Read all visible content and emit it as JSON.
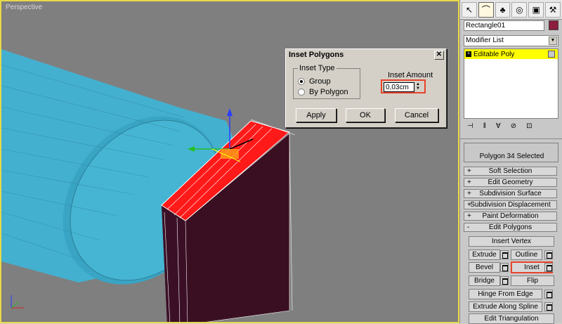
{
  "viewport": {
    "label": "Perspective"
  },
  "dialog": {
    "title": "Inset Polygons",
    "close_glyph": "✕",
    "inset_type_label": "Inset Type",
    "options": [
      "Group",
      "By Polygon"
    ],
    "selected_option": "Group",
    "inset_amount_label": "Inset Amount",
    "inset_amount_value": "0,03cm",
    "buttons": {
      "apply": "Apply",
      "ok": "OK",
      "cancel": "Cancel"
    }
  },
  "panel": {
    "tab_icons": [
      "create-icon",
      "modify-icon",
      "hierarchy-icon",
      "motion-icon",
      "display-icon",
      "utilities-icon"
    ],
    "object_name": "Rectangle01",
    "object_color": "#8c1e3e",
    "modifier_list": "Modifier List",
    "stack_item": "Editable Poly",
    "selection_text": "Polygon 34 Selected",
    "rollouts": [
      {
        "sign": "+",
        "label": "Soft Selection"
      },
      {
        "sign": "+",
        "label": "Edit Geometry"
      },
      {
        "sign": "+",
        "label": "Subdivision Surface"
      },
      {
        "sign": "+",
        "label": "Subdivision Displacement"
      },
      {
        "sign": "+",
        "label": "Paint Deformation"
      },
      {
        "sign": "-",
        "label": "Edit Polygons"
      }
    ],
    "edit_polygons": {
      "insert_vertex": "Insert Vertex",
      "extrude": "Extrude",
      "outline": "Outline",
      "bevel": "Bevel",
      "inset": "Inset",
      "bridge": "Bridge",
      "flip": "Flip",
      "hinge": "Hinge From Edge",
      "extrude_spline": "Extrude Along Spline",
      "edit_triangulation": "Edit Triangulation"
    }
  },
  "colors": {
    "highlight": "#e8432a",
    "selection_red": "#ff1a1a",
    "object_cyan": "#45b3d0"
  }
}
